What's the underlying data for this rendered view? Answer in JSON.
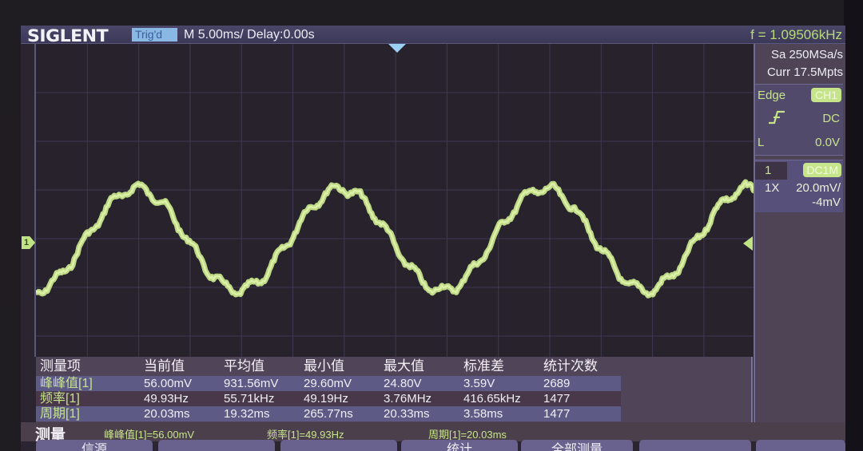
{
  "header": {
    "brand": "SIGLENT",
    "trigger_status": "Trig'd",
    "timebase": "M 5.00ms/ Delay:0.00s",
    "frequency_counter": "f = 1.09506kHz"
  },
  "acquisition": {
    "sample_rate": "Sa 250MSa/s",
    "memory_depth": "Curr 17.5Mpts"
  },
  "trigger": {
    "type": "Edge",
    "source": "CH1",
    "slope_icon": "rising-edge-icon",
    "coupling": "DC",
    "level_label": "L",
    "level": "0.0V"
  },
  "channel1": {
    "number": "1",
    "coupling": "DC1M",
    "probe": "1X",
    "scale": "20.0mV/",
    "offset": "-4mV",
    "marker_label": "1",
    "color": "#c6e48a"
  },
  "waveform": {
    "signal": "noisy sine",
    "approx_frequency_hz": 49.93,
    "divisions_shown_horizontal": 14,
    "peak_to_peak_mV": 56.0
  },
  "measurements": {
    "headers": [
      "测量项",
      "当前值",
      "平均值",
      "最小值",
      "最大值",
      "标准差",
      "统计次数"
    ],
    "rows": [
      {
        "name": "峰峰值[1]",
        "current": "56.00mV",
        "mean": "931.56mV",
        "min": "29.60mV",
        "max": "24.80V",
        "stddev": "3.59V",
        "count": "2689"
      },
      {
        "name": "频率[1]",
        "current": "49.93Hz",
        "mean": "55.71kHz",
        "min": "49.19Hz",
        "max": "3.76MHz",
        "stddev": "416.65kHz",
        "count": "1477"
      },
      {
        "name": "周期[1]",
        "current": "20.03ms",
        "mean": "19.32ms",
        "min": "265.77ns",
        "max": "20.33ms",
        "stddev": "3.58ms",
        "count": "1477"
      }
    ]
  },
  "measure_strip": {
    "title": "测量",
    "readouts": [
      "峰峰值[1]=56.00mV",
      "频率[1]=49.93Hz",
      "周期[1]=20.03ms"
    ]
  },
  "softkeys": [
    "信源",
    "",
    "",
    "统计",
    "全部测量",
    "",
    ""
  ],
  "colors": {
    "trace": "#c6e48a",
    "trigger_badge": "#8ab8e4",
    "grid": "#3f3a52"
  }
}
